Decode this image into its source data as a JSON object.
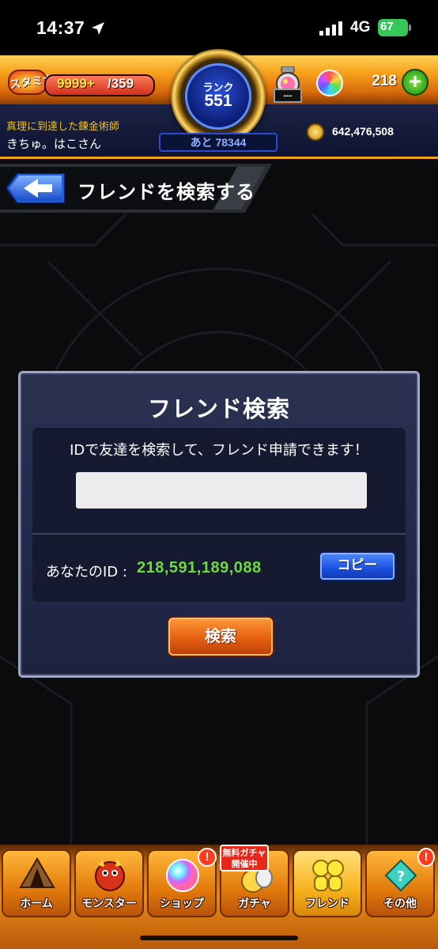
{
  "status_bar": {
    "time": "14:37",
    "network": "4G",
    "battery": "67"
  },
  "hud": {
    "stamina_label": "スタミナ",
    "stamina_value": "9999+",
    "stamina_max": "/359",
    "rank_label": "ランク",
    "rank_value": "551",
    "next_exp": "あと 78344",
    "potion_count": "---",
    "orb_count": "218",
    "plus_label": "+",
    "player_title": "真理に到達した錬金術師",
    "player_name": "きちゅ。はこさん",
    "coin_value": "642,476,508"
  },
  "header": {
    "title": "フレンドを検索する"
  },
  "dialog": {
    "title": "フレンド検索",
    "description": "IDで友達を検索して、フレンド申請できます！",
    "input_value": "",
    "your_id_label": "あなたのID :",
    "your_id_value": "218,591,189,088",
    "copy_label": "コピー",
    "search_label": "検索"
  },
  "bottom_nav": {
    "items": [
      {
        "label": "ホーム"
      },
      {
        "label": "モンスター"
      },
      {
        "label": "ショップ"
      },
      {
        "label": "ガチャ"
      },
      {
        "label": "フレンド"
      },
      {
        "label": "その他"
      }
    ],
    "badge": "!",
    "gacha_banner_line1": "無料ガチャ",
    "gacha_banner_line2": "開催中"
  },
  "colors": {
    "accent_orange": "#e98818",
    "id_green": "#6bdc3b",
    "copy_blue": "#1a4fe0",
    "search_orange": "#e55f10"
  }
}
